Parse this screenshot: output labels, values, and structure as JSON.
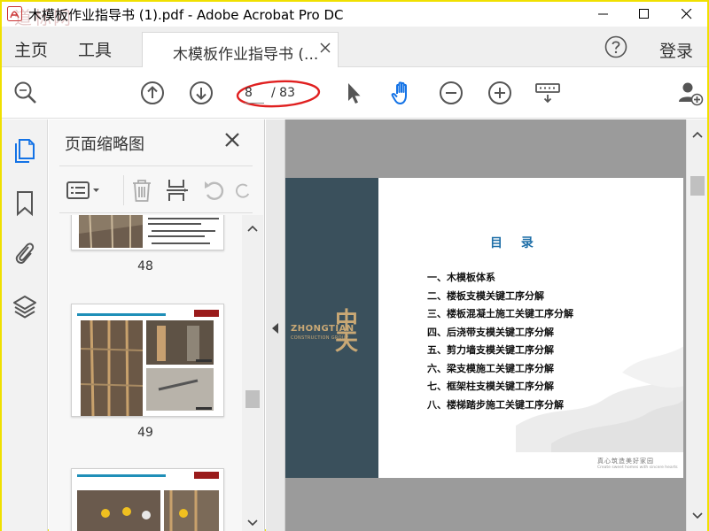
{
  "window": {
    "title": "木模板作业指导书 (1).pdf - Adobe Acrobat Pro DC",
    "watermark": "道标网"
  },
  "nav": {
    "home": "主页",
    "tools": "工具",
    "login": "登录"
  },
  "tab": {
    "label": "木模板作业指导书 (..."
  },
  "toolbar": {
    "current_page": "8",
    "total_pages": "/ 83"
  },
  "panel": {
    "title": "页面缩略图",
    "thumbnails": [
      {
        "page": "48"
      },
      {
        "page": "49"
      },
      {
        "page": ""
      }
    ]
  },
  "document": {
    "company_en": "ZHONGTIAN",
    "company_sub": "CONSTRUCTION GROUP",
    "company_cn": "中天",
    "toc_title": "目 录",
    "toc_items": [
      "一、木模板体系",
      "二、楼板支模关键工序分解",
      "三、楼板混凝土施工关键工序分解",
      "四、后浇带支模关键工序分解",
      "五、剪力墙支模关键工序分解",
      "六、梁支模施工关键工序分解",
      "七、框架柱支模关键工序分解",
      "八、楼梯踏步施工关键工序分解"
    ],
    "slogan": "真心筑造美好家园",
    "slogan_en": "Create sweet homes with sincere hearts"
  },
  "colors": {
    "accent_blue": "#1f6fa8",
    "band": "#3a505c",
    "gold": "#c9a875",
    "annotation_red": "#e02020",
    "viewer_bg": "#9b9b9b"
  }
}
